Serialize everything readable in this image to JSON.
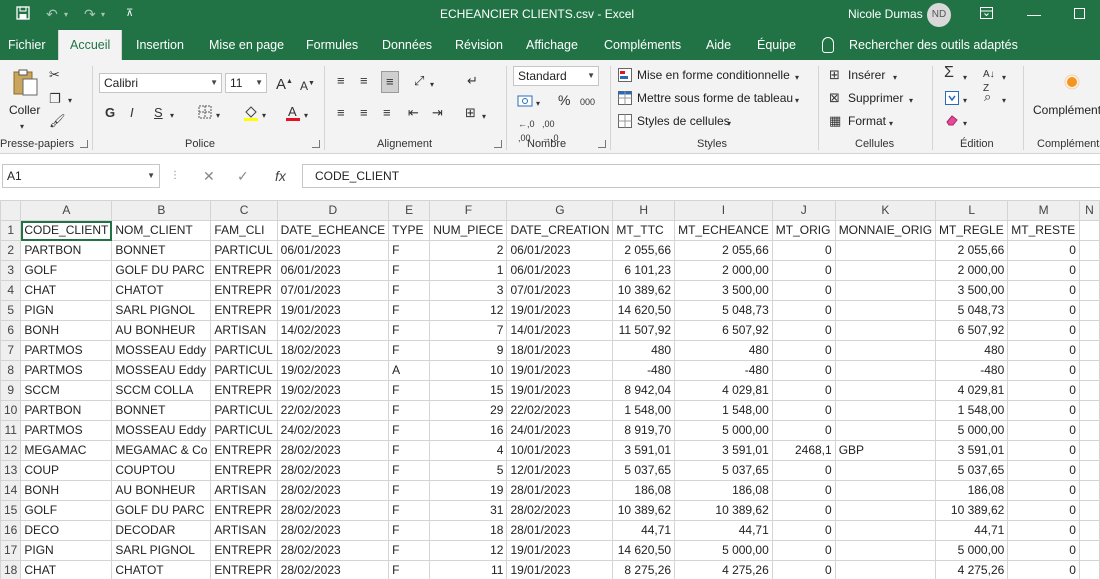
{
  "window": {
    "title": "ECHEANCIER CLIENTS.csv  -  Excel",
    "user": "Nicole Dumas",
    "initials": "ND"
  },
  "tabs": [
    "Fichier",
    "Accueil",
    "Insertion",
    "Mise en page",
    "Formules",
    "Données",
    "Révision",
    "Affichage",
    "Compléments",
    "Aide",
    "Équipe"
  ],
  "search_label": "Rechercher des outils adaptés",
  "ribbon": {
    "clipboard": {
      "paste": "Coller",
      "label": "Presse-papiers"
    },
    "font": {
      "name": "Calibri",
      "size": "11",
      "bold": "G",
      "italic": "I",
      "underline": "S",
      "label": "Police"
    },
    "alignment": {
      "label": "Alignement"
    },
    "number": {
      "format": "Standard",
      "percent": "%",
      "thousands": "000",
      "label": "Nombre"
    },
    "styles": {
      "conditional": "Mise en forme conditionnelle",
      "table": "Mettre sous forme de tableau",
      "cell": "Styles de cellules",
      "label": "Styles"
    },
    "cells": {
      "insert": "Insérer",
      "delete": "Supprimer",
      "format": "Format",
      "label": "Cellules"
    },
    "editing": {
      "label": "Édition"
    },
    "addins": {
      "button": "Compléments",
      "label": "Compléments"
    }
  },
  "formula_bar": {
    "cell_ref": "A1",
    "fx": "fx",
    "content": "CODE_CLIENT"
  },
  "columns": [
    "A",
    "B",
    "C",
    "D",
    "E",
    "F",
    "G",
    "H",
    "I",
    "J",
    "K",
    "L",
    "M",
    "N"
  ],
  "rows": [
    [
      "CODE_CLIENT",
      "NOM_CLIENT",
      "FAM_CLI",
      "DATE_ECHEANCE",
      "TYPE",
      "NUM_PIECE",
      "DATE_CREATION",
      "MT_TTC",
      "MT_ECHEANCE",
      "MT_ORIG",
      "MONNAIE_ORIG",
      "MT_REGLE",
      "MT_RESTE",
      ""
    ],
    [
      "PARTBON",
      "BONNET",
      "PARTICUL",
      "06/01/2023",
      "F",
      "2",
      "06/01/2023",
      "2 055,66",
      "2 055,66",
      "0",
      "",
      "2 055,66",
      "0",
      ""
    ],
    [
      "GOLF",
      "GOLF DU PARC",
      "ENTREPR",
      "06/01/2023",
      "F",
      "1",
      "06/01/2023",
      "6 101,23",
      "2 000,00",
      "0",
      "",
      "2 000,00",
      "0",
      ""
    ],
    [
      "CHAT",
      "CHATOT",
      "ENTREPR",
      "07/01/2023",
      "F",
      "3",
      "07/01/2023",
      "10 389,62",
      "3 500,00",
      "0",
      "",
      "3 500,00",
      "0",
      ""
    ],
    [
      "PIGN",
      "SARL PIGNOL",
      "ENTREPR",
      "19/01/2023",
      "F",
      "12",
      "19/01/2023",
      "14 620,50",
      "5 048,73",
      "0",
      "",
      "5 048,73",
      "0",
      ""
    ],
    [
      "BONH",
      "AU BONHEUR",
      "ARTISAN",
      "14/02/2023",
      "F",
      "7",
      "14/01/2023",
      "11 507,92",
      "6 507,92",
      "0",
      "",
      "6 507,92",
      "0",
      ""
    ],
    [
      "PARTMOS",
      "MOSSEAU Eddy",
      "PARTICUL",
      "18/02/2023",
      "F",
      "9",
      "18/01/2023",
      "480",
      "480",
      "0",
      "",
      "480",
      "0",
      ""
    ],
    [
      "PARTMOS",
      "MOSSEAU Eddy",
      "PARTICUL",
      "19/02/2023",
      "A",
      "10",
      "19/01/2023",
      "-480",
      "-480",
      "0",
      "",
      "-480",
      "0",
      ""
    ],
    [
      "SCCM",
      "SCCM COLLA",
      "ENTREPR",
      "19/02/2023",
      "F",
      "15",
      "19/01/2023",
      "8 942,04",
      "4 029,81",
      "0",
      "",
      "4 029,81",
      "0",
      ""
    ],
    [
      "PARTBON",
      "BONNET",
      "PARTICUL",
      "22/02/2023",
      "F",
      "29",
      "22/02/2023",
      "1 548,00",
      "1 548,00",
      "0",
      "",
      "1 548,00",
      "0",
      ""
    ],
    [
      "PARTMOS",
      "MOSSEAU Eddy",
      "PARTICUL",
      "24/02/2023",
      "F",
      "16",
      "24/01/2023",
      "8 919,70",
      "5 000,00",
      "0",
      "",
      "5 000,00",
      "0",
      ""
    ],
    [
      "MEGAMAC",
      "MEGAMAC & Co",
      "ENTREPR",
      "28/02/2023",
      "F",
      "4",
      "10/01/2023",
      "3 591,01",
      "3 591,01",
      "2468,1",
      "GBP",
      "3 591,01",
      "0",
      ""
    ],
    [
      "COUP",
      "COUPTOU",
      "ENTREPR",
      "28/02/2023",
      "F",
      "5",
      "12/01/2023",
      "5 037,65",
      "5 037,65",
      "0",
      "",
      "5 037,65",
      "0",
      ""
    ],
    [
      "BONH",
      "AU BONHEUR",
      "ARTISAN",
      "28/02/2023",
      "F",
      "19",
      "28/01/2023",
      "186,08",
      "186,08",
      "0",
      "",
      "186,08",
      "0",
      ""
    ],
    [
      "GOLF",
      "GOLF DU PARC",
      "ENTREPR",
      "28/02/2023",
      "F",
      "31",
      "28/02/2023",
      "10 389,62",
      "10 389,62",
      "0",
      "",
      "10 389,62",
      "0",
      ""
    ],
    [
      "DECO",
      "DECODAR",
      "ARTISAN",
      "28/02/2023",
      "F",
      "18",
      "28/01/2023",
      "44,71",
      "44,71",
      "0",
      "",
      "44,71",
      "0",
      ""
    ],
    [
      "PIGN",
      "SARL PIGNOL",
      "ENTREPR",
      "28/02/2023",
      "F",
      "12",
      "19/01/2023",
      "14 620,50",
      "5 000,00",
      "0",
      "",
      "5 000,00",
      "0",
      ""
    ],
    [
      "CHAT",
      "CHATOT",
      "ENTREPR",
      "28/02/2023",
      "F",
      "11",
      "19/01/2023",
      "8 275,26",
      "4 275,26",
      "0",
      "",
      "4 275,26",
      "0",
      ""
    ]
  ],
  "colors": {
    "excel_green": "#217346",
    "ribbon_bg": "#f3f3f3",
    "header_bg": "#efefef",
    "grid_line": "#d4d4d4"
  }
}
